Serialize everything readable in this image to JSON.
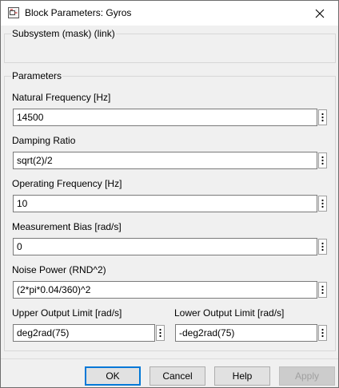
{
  "window": {
    "title": "Block Parameters: Gyros",
    "icons": {
      "app": "simulink-block-icon",
      "close": "close-icon"
    }
  },
  "subsystem": {
    "description": "Subsystem (mask) (link)"
  },
  "parameters": {
    "group_title": "Parameters",
    "natural_frequency": {
      "label": "Natural Frequency [Hz]",
      "value": "14500"
    },
    "damping_ratio": {
      "label": "Damping Ratio",
      "value": "sqrt(2)/2"
    },
    "operating_frequency": {
      "label": "Operating Frequency [Hz]",
      "value": "10"
    },
    "measurement_bias": {
      "label": "Measurement Bias [rad/s]",
      "value": "0"
    },
    "noise_power": {
      "label": "Noise Power (RND^2)",
      "value": "(2*pi*0.04/360)^2"
    },
    "upper_output_limit": {
      "label": "Upper Output Limit [rad/s]",
      "value": "deg2rad(75)"
    },
    "lower_output_limit": {
      "label": "Lower Output Limit [rad/s]",
      "value": "-deg2rad(75)"
    }
  },
  "buttons": {
    "ok": "OK",
    "cancel": "Cancel",
    "help": "Help",
    "apply": "Apply",
    "apply_enabled": false
  }
}
